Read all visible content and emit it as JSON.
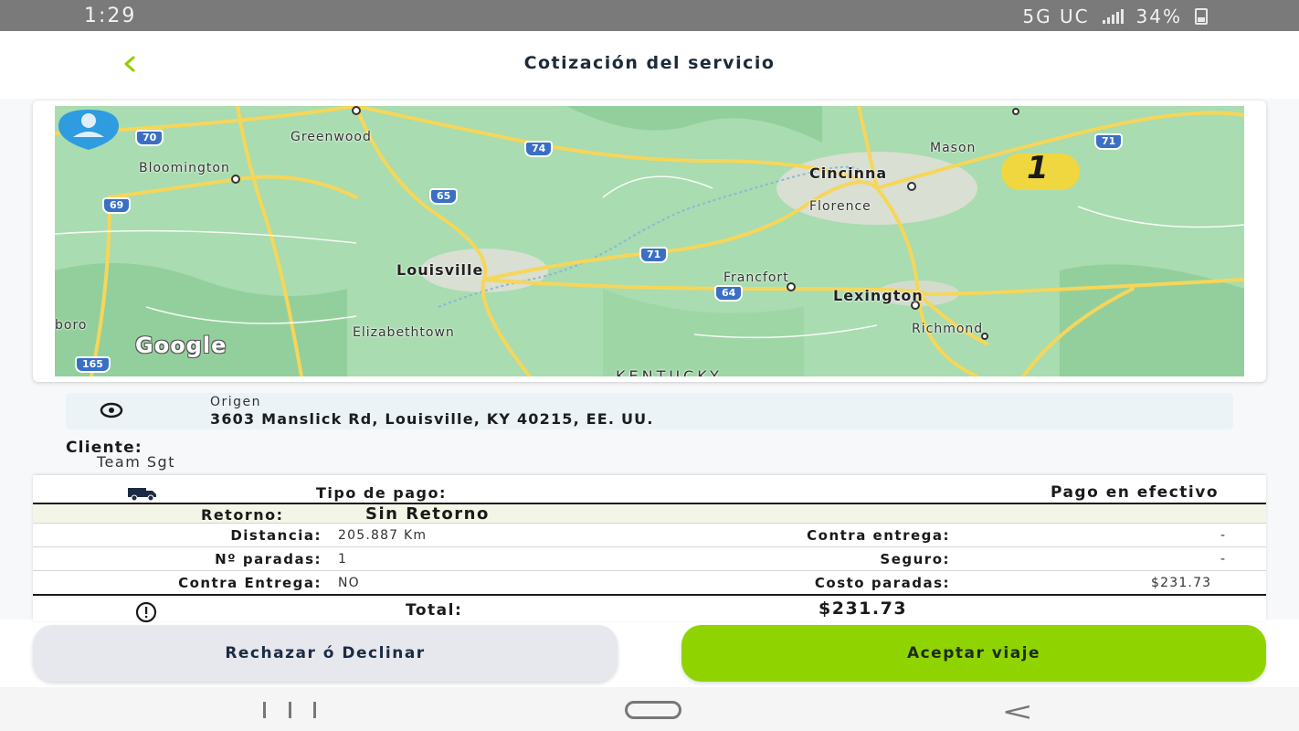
{
  "status_bar": {
    "time": "1:29",
    "network": "5G UC",
    "battery": "34%"
  },
  "header": {
    "back_icon": "chevron-left-icon",
    "title": "Cotización del servicio"
  },
  "map": {
    "labels": {
      "greenwood": "Greenwood",
      "bloomington": "Bloomington",
      "mason": "Mason",
      "cincinnati": "Cincinna",
      "florence": "Florence",
      "louisville": "Louisville",
      "francfort": "Francfort",
      "lexington": "Lexington",
      "boro": "boro",
      "elizabethtown": "Elizabethtown",
      "richmond": "Richmond",
      "kentucky": "KENTUCKY"
    },
    "shields": {
      "i70": "70",
      "i74": "74",
      "i71_top": "71",
      "i69": "69",
      "i65": "65",
      "i71": "71",
      "i64": "64",
      "i165": "165"
    },
    "attribution": "Google",
    "destination_marker": "1"
  },
  "origin": {
    "icon": "location-pin-icon",
    "label": "Origen",
    "address": "3603 Manslick Rd, Louisville, KY 40215, EE. UU."
  },
  "client": {
    "label": "Cliente:",
    "name": "Team Sgt"
  },
  "details": {
    "truck_icon": "truck-icon",
    "payment_type_label": "Tipo de pago:",
    "payment_type_value": "Pago en efectivo",
    "return_label": "Retorno:",
    "return_value": "Sin Retorno",
    "distance_label": "Distancia:",
    "distance_value": "205.887 Km",
    "cod_label": "Contra entrega:",
    "cod_value": "-",
    "stops_label": "Nº paradas:",
    "stops_value": "1",
    "insurance_label": "Seguro:",
    "insurance_value": "-",
    "cod2_label": "Contra Entrega:",
    "cod2_value": "NO",
    "stops_cost_label": "Costo paradas:",
    "stops_cost_value": "$231.73",
    "alert_icon": "alert-circle-icon",
    "total_label": "Total:",
    "total_value": "$231.73"
  },
  "actions": {
    "decline_label": "Rechazar ó Declinar",
    "accept_label": "Aceptar viaje"
  },
  "colors": {
    "accent": "#8fd400",
    "map_land": "#a9dcb0",
    "road": "#f6d65a",
    "status_bar": "#7a7a7a"
  }
}
